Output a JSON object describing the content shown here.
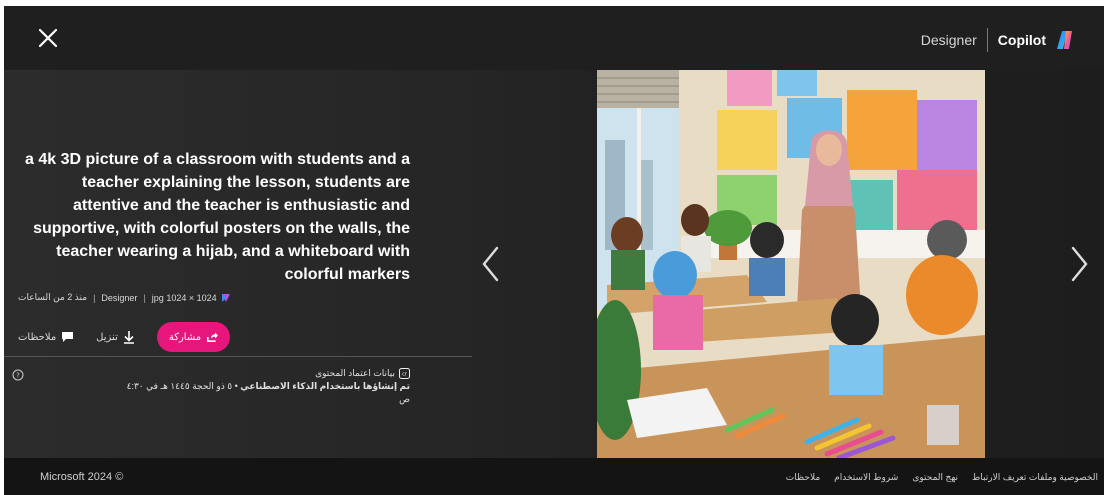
{
  "header": {
    "designer_label": "Designer",
    "copilot_label": "Copilot"
  },
  "prompt": "a 4k 3D picture of a classroom with students and a teacher explaining the lesson, students are attentive and the teacher is enthusiastic and supportive, with colorful posters on the walls, the teacher wearing a hijab, and a whiteboard with colorful markers",
  "meta": {
    "file": "1024 × 1024 jpg",
    "app": "Designer",
    "time": "منذ 2 من الساعات"
  },
  "actions": {
    "share": "مشاركة",
    "download": "تنزيل",
    "feedback": "ملاحظات"
  },
  "credentials": {
    "title": "بيانات اعتماد المحتوى",
    "line_bold": "تم إنشاؤها باستخدام الذكاء الاصطناعي",
    "line_date": "• ٥ ذو الحجة ١٤٤٥ هـ في ٤:٣٠ ص"
  },
  "footer": {
    "copyright": "Microsoft 2024 ©",
    "links": [
      "الخصوصية وملفات تعريف الارتباط",
      "نهج المحتوى",
      "شروط الاستخدام",
      "ملاحظات"
    ]
  },
  "colors": {
    "accent": "#e6167c",
    "background": "#1c1c1c"
  }
}
